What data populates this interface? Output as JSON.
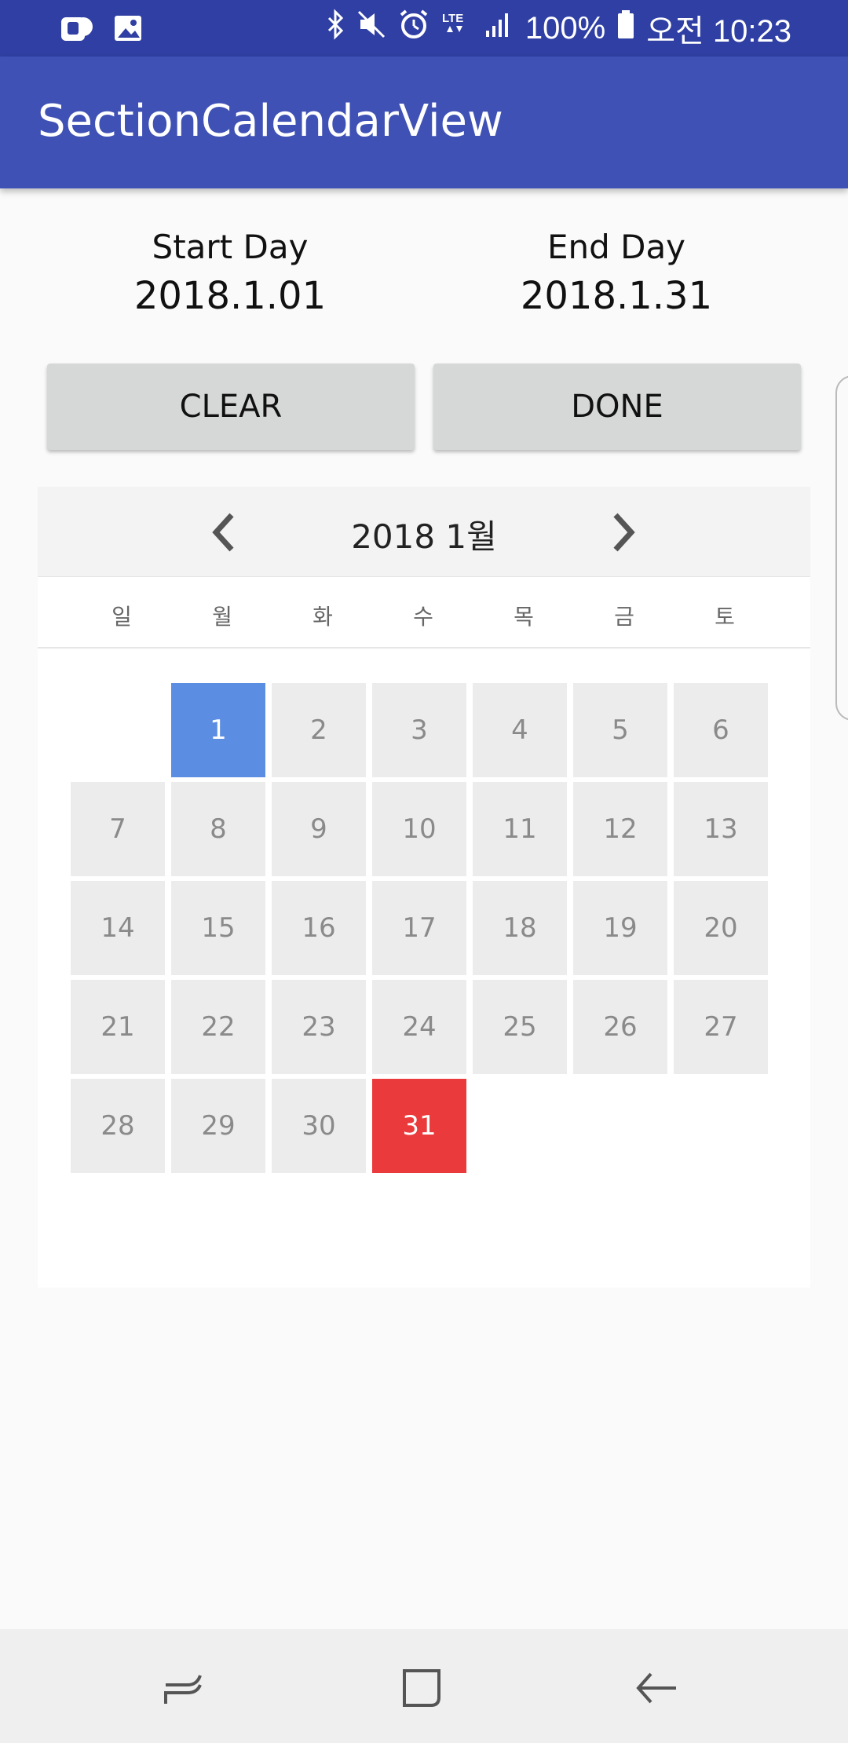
{
  "status_bar": {
    "battery": "100%",
    "time": "오전 10:23",
    "network": "LTE",
    "left_icons": [
      "app-notification-icon",
      "gallery-icon"
    ],
    "right_icons": [
      "bluetooth-icon",
      "mute-icon",
      "alarm-icon",
      "lte-icon",
      "signal-icon",
      "battery-icon"
    ]
  },
  "app_bar": {
    "title": "SectionCalendarView"
  },
  "range": {
    "start_label": "Start Day",
    "start_value": "2018.1.01",
    "end_label": "End Day",
    "end_value": "2018.1.31"
  },
  "buttons": {
    "clear": "CLEAR",
    "done": "DONE"
  },
  "calendar": {
    "month_title": "2018 1월",
    "prev_icon": "chevron-left-icon",
    "next_icon": "chevron-right-icon",
    "weekdays": [
      "일",
      "월",
      "화",
      "수",
      "목",
      "금",
      "토"
    ],
    "first_weekday_index": 1,
    "days": [
      "1",
      "2",
      "3",
      "4",
      "5",
      "6",
      "7",
      "8",
      "9",
      "10",
      "11",
      "12",
      "13",
      "14",
      "15",
      "16",
      "17",
      "18",
      "19",
      "20",
      "21",
      "22",
      "23",
      "24",
      "25",
      "26",
      "27",
      "28",
      "29",
      "30",
      "31"
    ],
    "selected_start": "1",
    "selected_end": "31"
  },
  "colors": {
    "status_bar": "#2f3fa3",
    "app_bar": "#3f51b5",
    "start_selection": "#5b8de2",
    "end_selection": "#ea3a3c",
    "day_cell": "#ececec"
  },
  "nav_bar": {
    "icons": [
      "recent-apps-icon",
      "home-icon",
      "back-icon"
    ]
  }
}
